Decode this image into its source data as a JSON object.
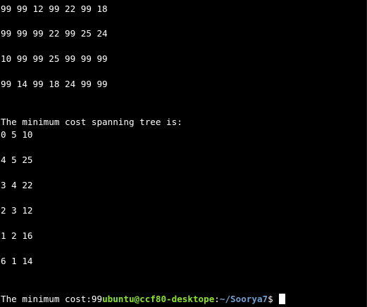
{
  "terminal": {
    "matrix_rows": [
      "99 99 12 99 22 99 18",
      "99 99 99 22 99 25 24",
      "10 99 99 25 99 99 99",
      "99 14 99 18 24 99 99"
    ],
    "heading": "The minimum cost spanning tree is:",
    "edges": [
      "0 5 10",
      "4 5 25",
      "3 4 22",
      "2 3 12",
      "1 2 16",
      "6 1 14"
    ],
    "result_text": "The minimum cost:99",
    "prompt_user": "ubuntu@ccf80-desktope",
    "prompt_sep": ":",
    "prompt_path": "~/Soorya7",
    "prompt_symbol": "$ "
  },
  "colors": {
    "background": "#000000",
    "text": "#ffffff",
    "prompt_user": "#8ae234",
    "prompt_path": "#729fcf"
  }
}
